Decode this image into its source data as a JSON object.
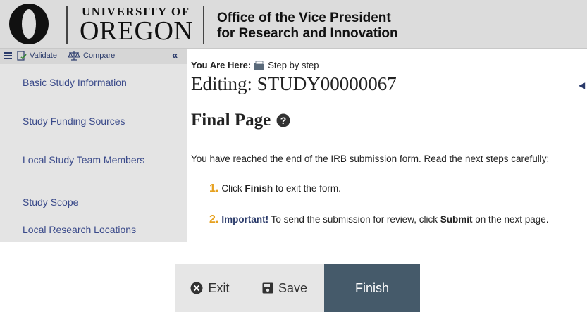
{
  "header": {
    "logo_university": "UNIVERSITY OF",
    "logo_oregon": "OREGON",
    "office_line1": "Office of the Vice President",
    "office_line2": "for Research and Innovation"
  },
  "sidebar": {
    "toolbar": {
      "validate_label": "Validate",
      "compare_label": "Compare",
      "collapse_icon": "double-chevron-left-icon"
    },
    "items": [
      {
        "label": "Basic Study Information"
      },
      {
        "label": "Study Funding Sources"
      },
      {
        "label": "Local Study Team Members"
      },
      {
        "label": "Study Scope"
      },
      {
        "label": "Local Research Locations"
      }
    ]
  },
  "main": {
    "you_are_here_label": "You Are Here:",
    "breadcrumb": "Step by step",
    "editing_title": "Editing: STUDY00000067",
    "page_title": "Final Page",
    "intro_text": "You have reached the end of the IRB submission form. Read the next steps carefully:",
    "steps": [
      {
        "number": "1.",
        "pre": "Click ",
        "bold": "Finish",
        "post": " to exit the form."
      },
      {
        "number": "2.",
        "important": "Important!",
        "pre": " To send the submission for review, click ",
        "bold": "Submit",
        "post": " on the next page."
      }
    ]
  },
  "footer": {
    "exit_label": "Exit",
    "save_label": "Save",
    "finish_label": "Finish"
  },
  "colors": {
    "brand_green": "#2a4a2a",
    "step_number": "#e6a11f",
    "link": "#3a4a8a",
    "finish_button": "#455a6a"
  }
}
